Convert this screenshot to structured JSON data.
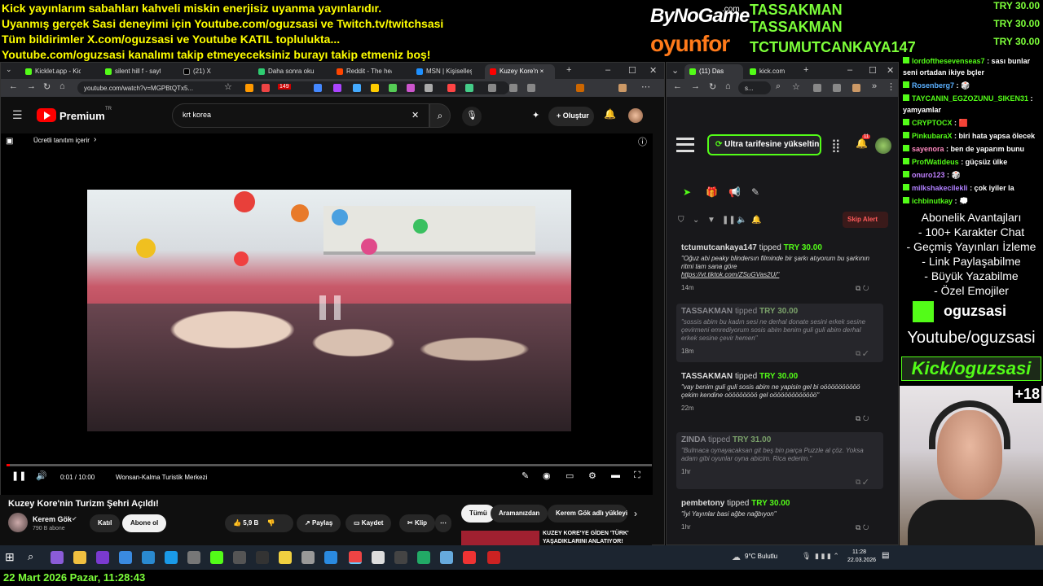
{
  "overlay": {
    "lines": [
      "Kick yayınlarım sabahları kahveli miskin enerjisiz uyanma yayınlarıdır.",
      "Uyanmış gerçek Sasi deneyimi için Youtube.com/oguzsasi ve Twitch.tv/twitchsasi",
      "Tüm bildirimler X.com/oguzsasi ve Youtube KATIL toplulukta...",
      "Youtube.com/oguzsasi kanalımı takip etmeyeceksiniz burayı takip etmeniz boş!"
    ],
    "sponsor1": "ByNoGame",
    "sponsor1_suffix": ".com",
    "sponsor2": "oyunfor",
    "donations": [
      {
        "name": "TASSAKMAN",
        "amount": "TRY 30.00"
      },
      {
        "name": "TASSAKMAN",
        "amount": "TRY 30.00"
      },
      {
        "name": "TCTUMUTCANKAYA147",
        "amount": "TRY 30.00"
      }
    ]
  },
  "left_browser": {
    "tabs": [
      {
        "label": "Kicklet.app - Kick",
        "color": "#53fc18"
      },
      {
        "label": "silent hill f - sayfa",
        "color": "#53fc18"
      },
      {
        "label": "(21) X",
        "color": "#000000"
      },
      {
        "label": "Daha sonra oku",
        "color": "#2ecc71"
      },
      {
        "label": "Reddit - The hear",
        "color": "#ff4500"
      },
      {
        "label": "MSN | Kişiselleştir",
        "color": "#1e90ff"
      },
      {
        "label": "Kuzey Kore'n",
        "color": "#ff0000"
      }
    ],
    "url": "youtube.com/watch?v=MGPBtQTx5...",
    "badge": "149"
  },
  "youtube": {
    "brand": "Premium",
    "brand_sup": "TR",
    "search_value": "krt korea",
    "create_label": "Oluştur",
    "promo_text": "Ücretli tanıtım içerir",
    "time_current": "0:01",
    "time_total": "10:00",
    "time_display": "0:01 / 10:00",
    "chapter": "Wonsan-Kalma Turistik Merkezi",
    "progress": 0.002,
    "video_title": "Kuzey Kore'nin Turizm Şehri Açıldı!",
    "channel": "Kerem Gök",
    "subscribers": "790 B abone",
    "join_label": "Katıl",
    "subscribe_label": "Abone ol",
    "likes": "5,9 B",
    "share_label": "Paylaş",
    "save_label": "Kaydet",
    "clip_label": "Klip",
    "filter_chips": [
      "Tümü",
      "Aramanızdan",
      "Kerem Gök adlı yükleyici"
    ],
    "rec_title_1": "KUZEY KORE'YE GİDEN 'TÜRK'",
    "rec_title_2": "YAŞADIKLARINI ANLATIYOR!"
  },
  "right_browser": {
    "tabs": [
      {
        "label": "(11) Das",
        "color": "#53fc18"
      },
      {
        "label": "kick.com",
        "color": "#53fc18"
      }
    ],
    "url": "s...",
    "upgrade_label": "Ultra tarifesine yükseltin",
    "notif_count": "11",
    "skip_label": "Skip Alert",
    "tips": [
      {
        "user": "tctumutcankaya147",
        "verb": "tipped",
        "amount": "TRY 30.00",
        "msg": "\"Oğuz abi peaky blindersın filminde bir şarkı atıyorum bu şarkının ritmi tam sana göre",
        "link": "https://vt.tiktok.com/ZSuGVas2U/\"",
        "time": "14m",
        "dim": false
      },
      {
        "user": "TASSAKMAN",
        "verb": "tipped",
        "amount": "TRY 30.00",
        "msg": "\"sossis abim bu kadın sesi ne derhal donate sesini erkek sesine çevirmeni emrediyorum sosis abim benim guli guli abim derhal erkek sesine çevir hemen\"",
        "link": "",
        "time": "18m",
        "dim": true
      },
      {
        "user": "TASSAKMAN",
        "verb": "tipped",
        "amount": "TRY 30.00",
        "msg": "\"vay benim guli guli sosis abim ne yapisin gel bi oöööööööööö çekim kendine oöööööööö gel oöööööööööööö\"",
        "link": "",
        "time": "22m",
        "dim": false
      },
      {
        "user": "ZINDA",
        "verb": "tipped",
        "amount": "TRY 31.00",
        "msg": "\"Bulmaca oynayacaksan git beş bin parça Puzzle al çöz. Yoksa adam gibi oyunlar oyna abicim. Rica ederim.\"",
        "link": "",
        "time": "1hr",
        "dim": true
      },
      {
        "user": "pembetony",
        "verb": "tipped",
        "amount": "TRY 30.00",
        "msg": "\"İyi Yayınlar basi ağbe nağbıyon\"",
        "link": "",
        "time": "1hr",
        "dim": false
      }
    ]
  },
  "chat": [
    {
      "user": "lordofthesevenseas7",
      "msg": ": sası bunlar"
    },
    {
      "user": "",
      "msg": "seni ortadan ikiye bçler"
    },
    {
      "user": "Rosenberg7",
      "msg": ": 🎲"
    },
    {
      "user": "TAYCANIN_EGZOZUNU_SIKEN31",
      "msg": ":"
    },
    {
      "user": "",
      "msg": "yamyamlar"
    },
    {
      "user": "CRYPTOCX",
      "msg": ": 🟥"
    },
    {
      "user": "PinkubaraX",
      "msg": ": biri hata yapsa ölecek"
    },
    {
      "user": "sayenora",
      "msg": ": ben de yaparım bunu"
    },
    {
      "user": "ProfWatideus",
      "msg": ": güçsüz ülke"
    },
    {
      "user": "onuro123",
      "msg": ": 🎲"
    },
    {
      "user": "milkshakecilekli",
      "msg": ": çok iyiler la"
    },
    {
      "user": "ichbinutkay",
      "msg": ": 💭"
    }
  ],
  "perks": [
    "Abonelik Avantajları",
    "- 100+ Karakter Chat",
    "- Geçmiş Yayınları İzleme",
    "- Link Paylaşabilme",
    "- Büyük Yazabilme",
    "- Özel Emojiler"
  ],
  "kick_user": "oguzsasi",
  "youtube_handle": "Youtube/oguzsasi",
  "kick_handle": "Kick/oguzsasi",
  "age_badge": "+18",
  "taskbar": {
    "weather": "9°C  Bulutlu",
    "time": "11:28",
    "date": "22.03.2026"
  },
  "bottom_datetime": "22 Mart 2026 Pazar, 11:28:43",
  "colors": {
    "kick_green": "#53fc18",
    "yt_red": "#ff0000",
    "overlay_yellow": "#ffff00"
  }
}
